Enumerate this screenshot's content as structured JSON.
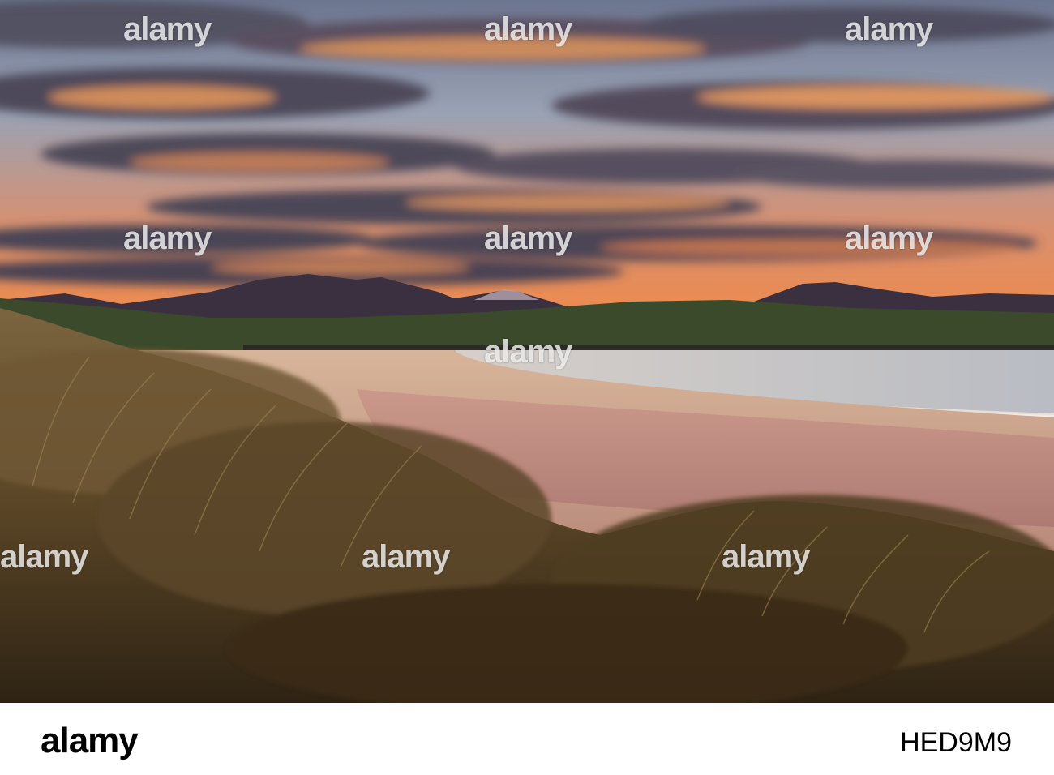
{
  "watermark": {
    "text": "alamy"
  },
  "footer": {
    "logo": "alamy",
    "image_id": "HED9M9"
  },
  "colors": {
    "sky_top": "#7e8aa0",
    "sky_glow": "#e8884a",
    "cloud_dark": "#4e4a5a",
    "cloud_lit": "#e69a5c",
    "mountain": "#3a3040",
    "hill": "#3b4a2a",
    "beach_sand": "#c89a86",
    "sea": "#c7c3c4",
    "grass": "#5a4526"
  }
}
